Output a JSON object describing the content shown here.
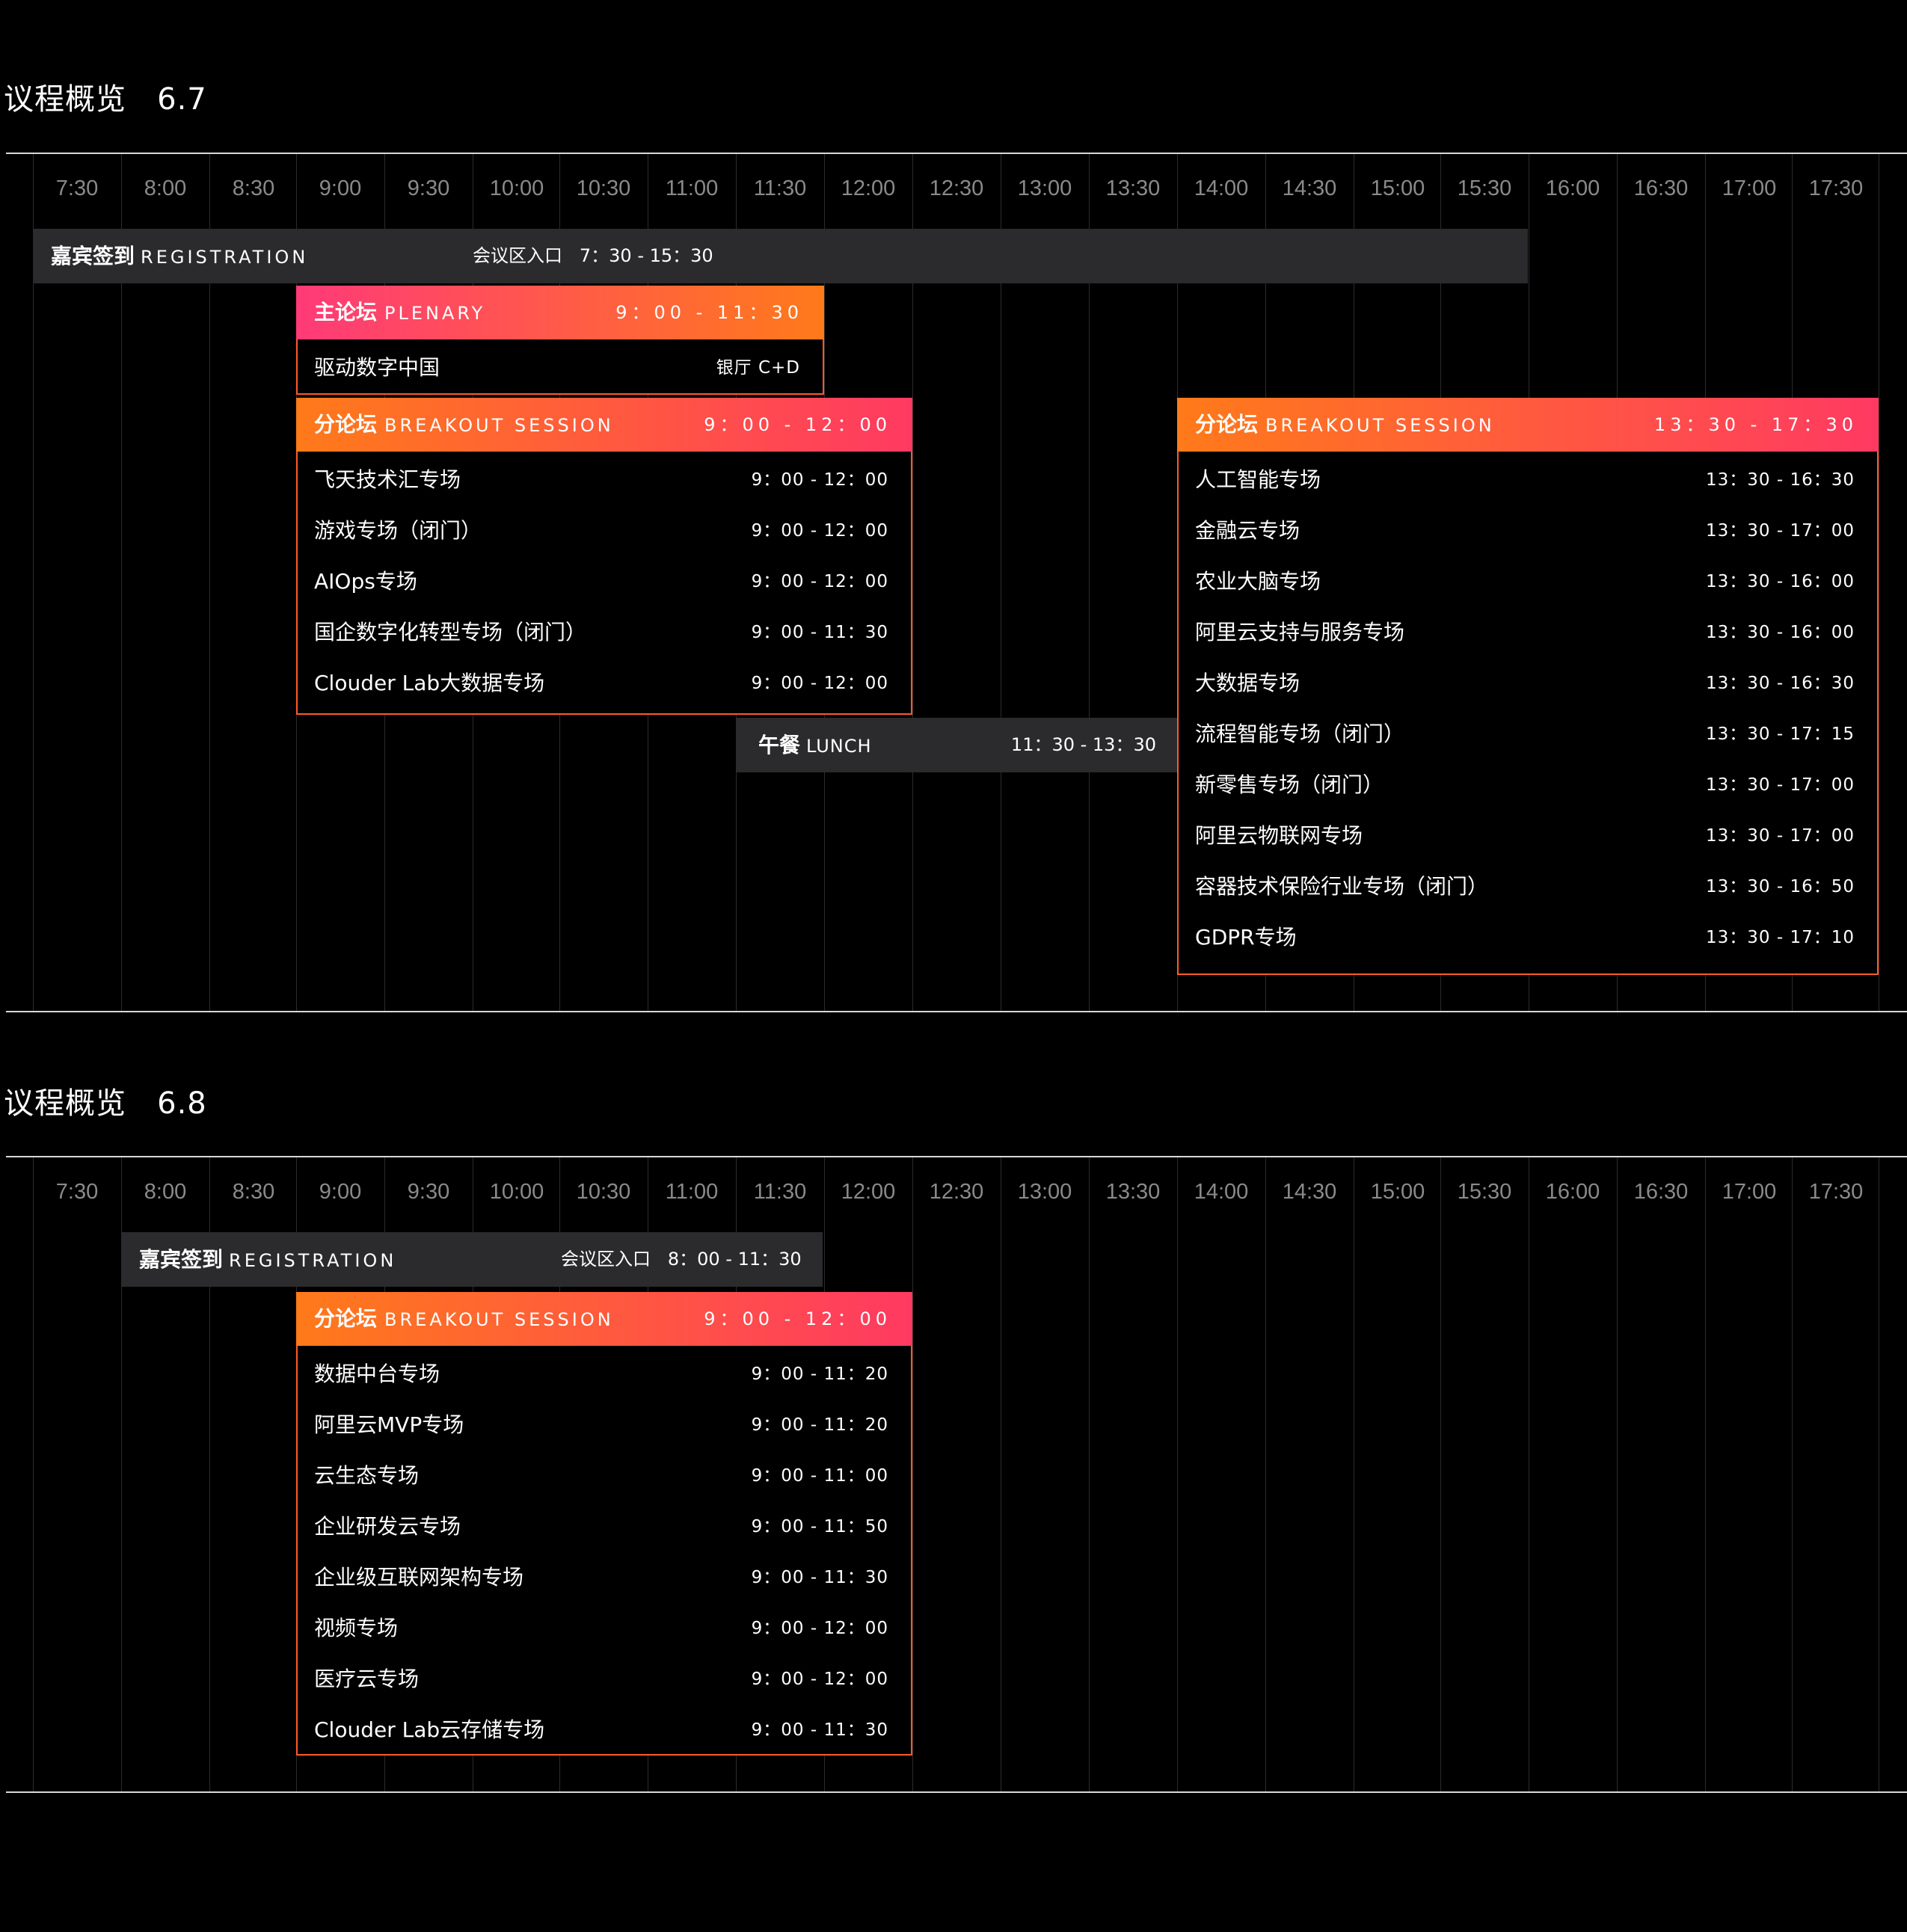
{
  "day1": {
    "title": "议程概览   6.7",
    "hours": [
      "7:30",
      "8:00",
      "8:30",
      "9:00",
      "9:30",
      "10:00",
      "10:30",
      "11:00",
      "11:30",
      "12:00",
      "12:30",
      "13:00",
      "13:30",
      "14:00",
      "14:30",
      "15:00",
      "15:30",
      "16:00",
      "16:30",
      "17:00",
      "17:30"
    ],
    "registration": {
      "cn": "嘉宾签到",
      "en": "REGISTRATION",
      "location": "会议区入口",
      "time": "7：30 - 15：30"
    },
    "plenary": {
      "cn": "主论坛",
      "en": "PLENARY",
      "time": "9：00 - 11：30",
      "topic": "驱动数字中国",
      "room": "银厅 C+D"
    },
    "breakout_am": {
      "cn": "分论坛",
      "en": "BREAKOUT SESSION",
      "time": "9：00 - 12：00",
      "items": [
        {
          "name": "飞天技术汇专场",
          "time": "9：00 - 12：00"
        },
        {
          "name": "游戏专场（闭门）",
          "time": "9：00 - 12：00"
        },
        {
          "name": "AIOps专场",
          "time": "9：00 - 12：00"
        },
        {
          "name": "国企数字化转型专场（闭门）",
          "time": "9：00 - 11：30"
        },
        {
          "name": "Clouder Lab大数据专场",
          "time": "9：00 - 12：00"
        }
      ]
    },
    "lunch": {
      "cn": "午餐",
      "en": "LUNCH",
      "time": "11：30 - 13：30"
    },
    "breakout_pm": {
      "cn": "分论坛",
      "en": "BREAKOUT SESSION",
      "time": "13：30 - 17：30",
      "items": [
        {
          "name": "人工智能专场",
          "time": "13：30 - 16：30"
        },
        {
          "name": "金融云专场",
          "time": "13：30 - 17：00"
        },
        {
          "name": "农业大脑专场",
          "time": "13：30 - 16：00"
        },
        {
          "name": "阿里云支持与服务专场",
          "time": "13：30 - 16：00"
        },
        {
          "name": "大数据专场",
          "time": "13：30 - 16：30"
        },
        {
          "name": "流程智能专场（闭门）",
          "time": "13：30 - 17：15"
        },
        {
          "name": "新零售专场（闭门）",
          "time": "13：30 - 17：00"
        },
        {
          "name": "阿里云物联网专场",
          "time": "13：30 - 17：00"
        },
        {
          "name": "容器技术保险行业专场（闭门）",
          "time": "13：30 - 16：50"
        },
        {
          "name": "GDPR专场",
          "time": "13：30 - 17：10"
        }
      ]
    }
  },
  "day2": {
    "title": "议程概览   6.8",
    "hours": [
      "7:30",
      "8:00",
      "8:30",
      "9:00",
      "9:30",
      "10:00",
      "10:30",
      "11:00",
      "11:30",
      "12:00",
      "12:30",
      "13:00",
      "13:30",
      "14:00",
      "14:30",
      "15:00",
      "15:30",
      "16:00",
      "16:30",
      "17:00",
      "17:30"
    ],
    "registration": {
      "cn": "嘉宾签到",
      "en": "REGISTRATION",
      "location": "会议区入口",
      "time": "8：00 - 11：30"
    },
    "breakout": {
      "cn": "分论坛",
      "en": "BREAKOUT SESSION",
      "time": "9：00 - 12：00",
      "items": [
        {
          "name": "数据中台专场",
          "time": "9：00 - 11：20"
        },
        {
          "name": "阿里云MVP专场",
          "time": "9：00 - 11：20"
        },
        {
          "name": "云生态专场",
          "time": "9：00 - 11：00"
        },
        {
          "name": "企业研发云专场",
          "time": "9：00 - 11：50"
        },
        {
          "name": "企业级互联网架构专场",
          "time": "9：00 - 11：30"
        },
        {
          "name": "视频专场",
          "time": "9：00 - 12：00"
        },
        {
          "name": "医疗云专场",
          "time": "9：00 - 12：00"
        },
        {
          "name": "Clouder Lab云存储专场",
          "time": "9：00 - 11：30"
        }
      ]
    }
  },
  "colors": {
    "background": "#000000",
    "grey_bar": "#2b2b2d",
    "border_orange": "#ff5a2a",
    "gradient_pink": "#ff3a78",
    "gradient_orange": "#ff7a1a"
  }
}
